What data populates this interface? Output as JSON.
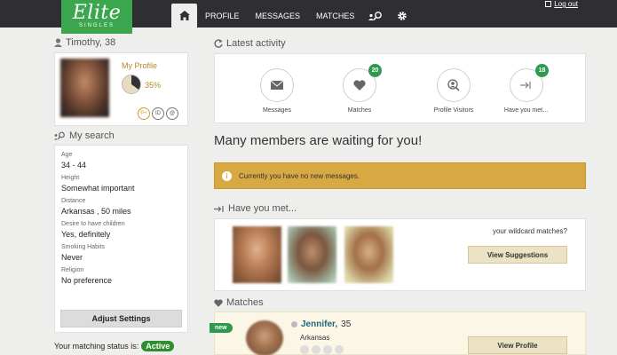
{
  "brand": {
    "word": "Elite",
    "sub": "SINGLES"
  },
  "nav": {
    "items": [
      "PROFILE",
      "MESSAGES",
      "MATCHES"
    ],
    "logout": "Log out"
  },
  "profile": {
    "name_line": "Timothy, 38",
    "my_profile": "My Profile",
    "completion": "35%",
    "completion_fraction": 0.35,
    "badges": [
      "P+",
      "ID",
      "@"
    ]
  },
  "search": {
    "title": "My search",
    "criteria": [
      {
        "label": "Age",
        "value": "34 - 44"
      },
      {
        "label": "Height",
        "value": "Somewhat important"
      },
      {
        "label": "Distance",
        "value": "Arkansas , 50 miles"
      },
      {
        "label": "Desire to have children",
        "value": "Yes, definitely"
      },
      {
        "label": "Smoking Habits",
        "value": "Never"
      },
      {
        "label": "Religion",
        "value": "No preference"
      }
    ],
    "adjust_label": "Adjust Settings",
    "status_label": "Your matching status is:",
    "status_value": "Active"
  },
  "activity": {
    "title": "Latest activity",
    "items": [
      {
        "label": "Messages",
        "icon": "envelope-icon",
        "count": ""
      },
      {
        "label": "Matches",
        "icon": "heart-icon",
        "count": "20"
      },
      {
        "label": "Profile Visitors",
        "icon": "visitor-icon",
        "count": ""
      },
      {
        "label": "Have you met…",
        "icon": "arrow-in-icon",
        "count": "18"
      }
    ]
  },
  "main": {
    "waiting": "Many members are waiting for you!",
    "alert": "Currently you have no new messages."
  },
  "have_you_met": {
    "title": "Have you met...",
    "wildcard": "your wildcard matches?",
    "button": "View Suggestions"
  },
  "matches": {
    "title": "Matches",
    "tag": "new",
    "name": "Jennifer,",
    "age": "35",
    "location": "Arkansas",
    "button": "View Profile"
  },
  "colors": {
    "brand_green": "#3aa64e",
    "topbar": "#2f2f33",
    "alert": "#d8a842",
    "count_badge": "#2e9a4e",
    "gold_text": "#b58a22"
  }
}
